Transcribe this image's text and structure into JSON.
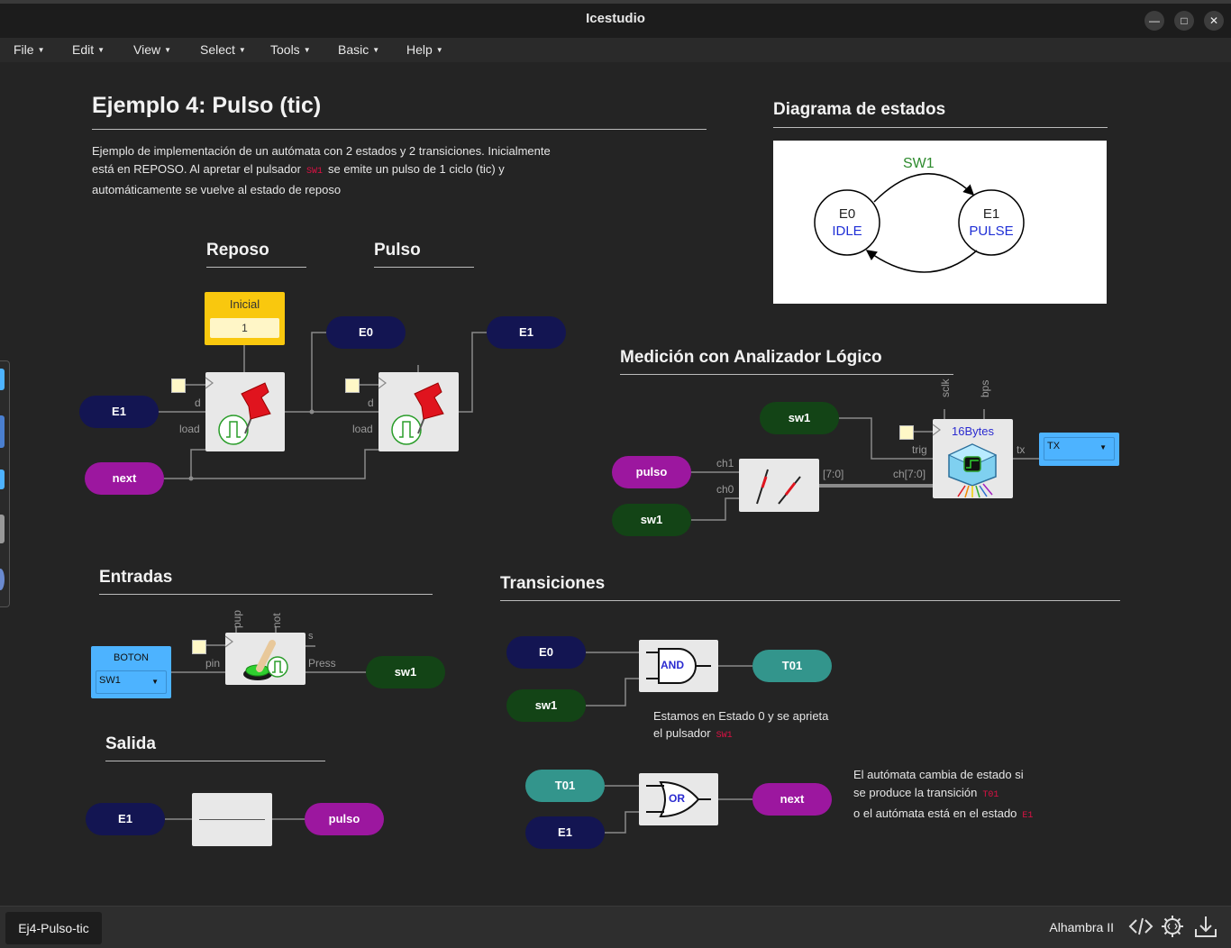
{
  "window": {
    "title": "Icestudio"
  },
  "menu": [
    "File",
    "Edit",
    "View",
    "Select",
    "Tools",
    "Basic",
    "Help"
  ],
  "page": {
    "title": "Ejemplo 4: Pulso (tic)",
    "description": [
      "Ejemplo de implementación de un autómata con 2 estados y 2 transiciones. Inicialmente",
      "está en REPOSO. Al apretar el pulsador",
      "SW1",
      "se emite un pulso de 1 ciclo (tic) y",
      "automáticamente se vuelve al estado de reposo"
    ]
  },
  "sections": {
    "reposo": "Reposo",
    "pulso": "Pulso",
    "diagrama": "Diagrama de estados",
    "medicion": "Medición con Analizador Lógico",
    "entradas": "Entradas",
    "transiciones": "Transiciones",
    "salida": "Salida"
  },
  "state_diagram": {
    "transition": "SW1",
    "e0_name": "E0",
    "e0_state": "IDLE",
    "e1_name": "E1",
    "e1_state": "PULSE"
  },
  "constant": {
    "label": "Inicial",
    "value": "1"
  },
  "ports": {
    "d": "d",
    "load": "load",
    "pin": "pin",
    "press": "Press",
    "pup": "pup",
    "not": "not",
    "s": "s",
    "ch1": "ch1",
    "ch0": "ch0",
    "bus": "[7:0]",
    "chbus": "ch[7:0]",
    "trig": "trig",
    "tx": "tx",
    "sclk": "sclk",
    "bps": "bps"
  },
  "labels": {
    "e0": "E0",
    "e1": "E1",
    "next": "next",
    "sw1": "sw1",
    "pulso": "pulso",
    "t01": "T01"
  },
  "analyzer": {
    "name": "16Bytes",
    "tx_select": "TX"
  },
  "boton": {
    "label": "BOTON",
    "select": "SW1"
  },
  "gates": {
    "and": "AND",
    "or": "OR"
  },
  "notes": {
    "transition": [
      "Estamos en Estado 0 y se aprieta",
      "el pulsador",
      "SW1"
    ],
    "change": [
      "El autómata cambia de estado si",
      "se produce la transición",
      "T01",
      "o el autómata está en el estado",
      "E1"
    ]
  },
  "status": {
    "tab": "Ej4-Pulso-tic",
    "board": "Alhambra II"
  },
  "colors": {
    "navy": "#131552",
    "purple": "#9c179f",
    "green": "#134416",
    "teal": "#33958c",
    "constant": "#f9c80e",
    "input": "#4db3ff"
  }
}
